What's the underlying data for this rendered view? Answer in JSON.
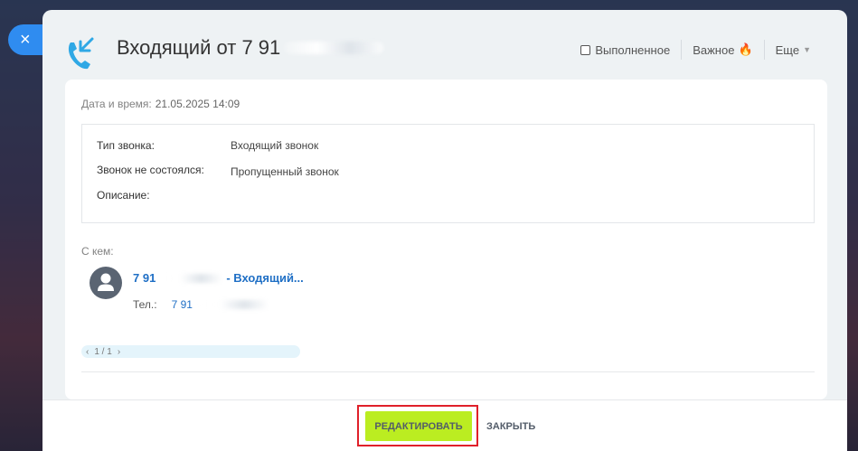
{
  "side_tab": {
    "close_glyph": "×"
  },
  "header": {
    "title_prefix": "Входящий от",
    "phone_visible": "7 91",
    "done_label": "Выполненное",
    "important_label": "Важное",
    "more_label": "Еще",
    "call_icon": "incoming-call-icon",
    "accent_color": "#2fa8e5"
  },
  "details": {
    "datetime_label": "Дата и время:",
    "datetime_value": "21.05.2025 14:09",
    "rows": [
      {
        "label": "Тип звонка:",
        "value": "Входящий звонок"
      },
      {
        "label": "Звонок не состоялся:",
        "value": "Пропущенный звонок"
      },
      {
        "label": "Описание:",
        "value": ""
      }
    ]
  },
  "contact": {
    "with_label": "С кем:",
    "link_prefix": "7 91",
    "link_suffix": "- Входящий...",
    "tel_label": "Тел.:",
    "tel_prefix": "7 91",
    "link_color": "#1f6fc5"
  },
  "pager": {
    "prev": "‹",
    "text": "1 / 1",
    "next": "›"
  },
  "footer": {
    "edit_label": "РЕДАКТИРОВАТЬ",
    "close_label": "ЗАКРЫТЬ",
    "edit_color": "#bbed21",
    "highlight_color": "#e0202a"
  }
}
